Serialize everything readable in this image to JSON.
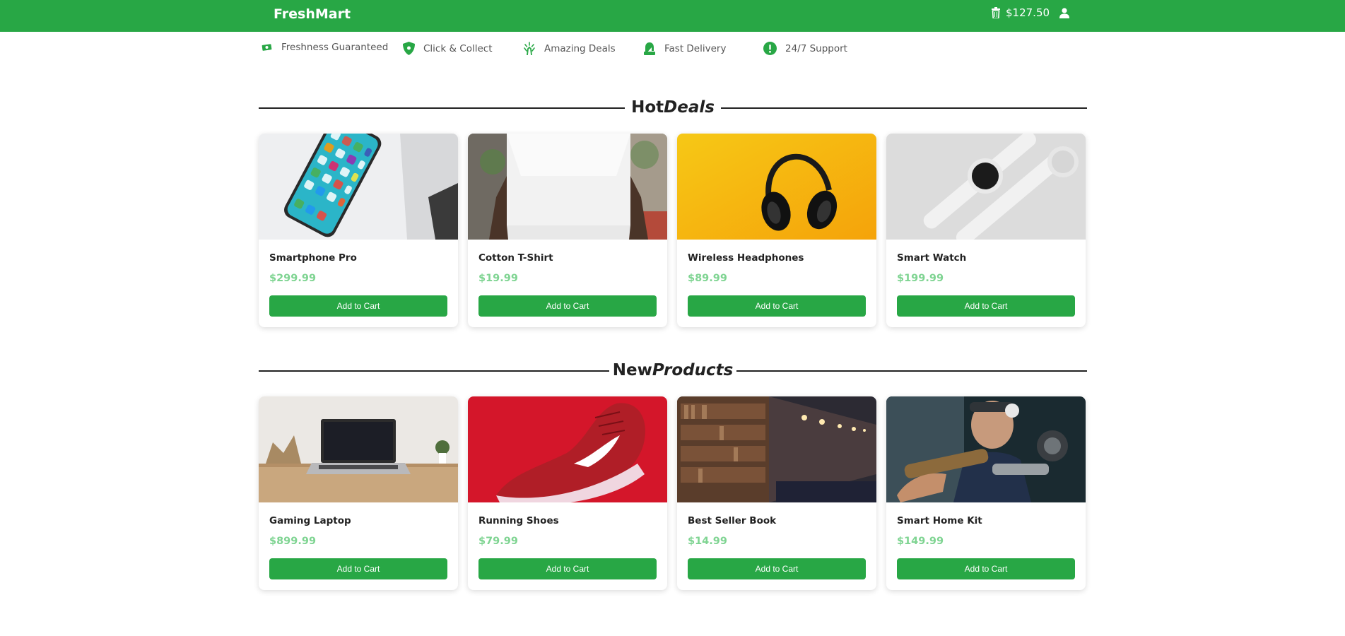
{
  "header": {
    "brand": "FreshMart",
    "cart_total": "$127.50",
    "cart_icon": "trash-bin-icon",
    "user_icon": "user-icon",
    "background_color": "#28a745"
  },
  "features": [
    {
      "label": "Freshness Guaranteed",
      "icon": "money-bill-icon"
    },
    {
      "label": "Click & Collect",
      "icon": "shield-icon"
    },
    {
      "label": "Amazing Deals",
      "icon": "hand-sparkle-icon"
    },
    {
      "label": "Fast Delivery",
      "icon": "user-headset-icon"
    },
    {
      "label": "24/7 Support",
      "icon": "exclamation-circle-icon"
    }
  ],
  "sections": {
    "hot_deals": {
      "title_plain": "Hot",
      "title_italic": "Deals",
      "products": [
        {
          "name": "Smartphone Pro",
          "price": "$299.99",
          "button": "Add to Cart",
          "image": "smartphone-photo"
        },
        {
          "name": "Cotton T-Shirt",
          "price": "$19.99",
          "button": "Add to Cart",
          "image": "tshirt-photo"
        },
        {
          "name": "Wireless Headphones",
          "price": "$89.99",
          "button": "Add to Cart",
          "image": "headphones-photo"
        },
        {
          "name": "Smart Watch",
          "price": "$199.99",
          "button": "Add to Cart",
          "image": "smartwatch-photo"
        }
      ]
    },
    "new_products": {
      "title_plain": "New",
      "title_italic": "Products",
      "products": [
        {
          "name": "Gaming Laptop",
          "price": "$899.99",
          "button": "Add to Cart",
          "image": "laptop-photo"
        },
        {
          "name": "Running Shoes",
          "price": "$79.99",
          "button": "Add to Cart",
          "image": "shoes-photo"
        },
        {
          "name": "Best Seller Book",
          "price": "$14.99",
          "button": "Add to Cart",
          "image": "bookshelf-photo"
        },
        {
          "name": "Smart Home Kit",
          "price": "$149.99",
          "button": "Add to Cart",
          "image": "workshop-photo"
        }
      ]
    }
  },
  "colors": {
    "accent": "#28a745",
    "price": "#7fd492"
  }
}
